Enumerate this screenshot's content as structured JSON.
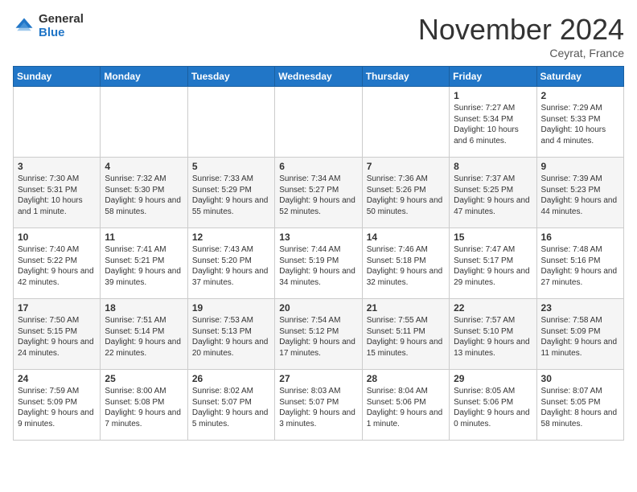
{
  "logo": {
    "general": "General",
    "blue": "Blue"
  },
  "header": {
    "month": "November 2024",
    "location": "Ceyrat, France"
  },
  "days_header": [
    "Sunday",
    "Monday",
    "Tuesday",
    "Wednesday",
    "Thursday",
    "Friday",
    "Saturday"
  ],
  "weeks": [
    [
      {
        "day": "",
        "content": ""
      },
      {
        "day": "",
        "content": ""
      },
      {
        "day": "",
        "content": ""
      },
      {
        "day": "",
        "content": ""
      },
      {
        "day": "",
        "content": ""
      },
      {
        "day": "1",
        "content": "Sunrise: 7:27 AM\nSunset: 5:34 PM\nDaylight: 10 hours and 6 minutes."
      },
      {
        "day": "2",
        "content": "Sunrise: 7:29 AM\nSunset: 5:33 PM\nDaylight: 10 hours and 4 minutes."
      }
    ],
    [
      {
        "day": "3",
        "content": "Sunrise: 7:30 AM\nSunset: 5:31 PM\nDaylight: 10 hours and 1 minute."
      },
      {
        "day": "4",
        "content": "Sunrise: 7:32 AM\nSunset: 5:30 PM\nDaylight: 9 hours and 58 minutes."
      },
      {
        "day": "5",
        "content": "Sunrise: 7:33 AM\nSunset: 5:29 PM\nDaylight: 9 hours and 55 minutes."
      },
      {
        "day": "6",
        "content": "Sunrise: 7:34 AM\nSunset: 5:27 PM\nDaylight: 9 hours and 52 minutes."
      },
      {
        "day": "7",
        "content": "Sunrise: 7:36 AM\nSunset: 5:26 PM\nDaylight: 9 hours and 50 minutes."
      },
      {
        "day": "8",
        "content": "Sunrise: 7:37 AM\nSunset: 5:25 PM\nDaylight: 9 hours and 47 minutes."
      },
      {
        "day": "9",
        "content": "Sunrise: 7:39 AM\nSunset: 5:23 PM\nDaylight: 9 hours and 44 minutes."
      }
    ],
    [
      {
        "day": "10",
        "content": "Sunrise: 7:40 AM\nSunset: 5:22 PM\nDaylight: 9 hours and 42 minutes."
      },
      {
        "day": "11",
        "content": "Sunrise: 7:41 AM\nSunset: 5:21 PM\nDaylight: 9 hours and 39 minutes."
      },
      {
        "day": "12",
        "content": "Sunrise: 7:43 AM\nSunset: 5:20 PM\nDaylight: 9 hours and 37 minutes."
      },
      {
        "day": "13",
        "content": "Sunrise: 7:44 AM\nSunset: 5:19 PM\nDaylight: 9 hours and 34 minutes."
      },
      {
        "day": "14",
        "content": "Sunrise: 7:46 AM\nSunset: 5:18 PM\nDaylight: 9 hours and 32 minutes."
      },
      {
        "day": "15",
        "content": "Sunrise: 7:47 AM\nSunset: 5:17 PM\nDaylight: 9 hours and 29 minutes."
      },
      {
        "day": "16",
        "content": "Sunrise: 7:48 AM\nSunset: 5:16 PM\nDaylight: 9 hours and 27 minutes."
      }
    ],
    [
      {
        "day": "17",
        "content": "Sunrise: 7:50 AM\nSunset: 5:15 PM\nDaylight: 9 hours and 24 minutes."
      },
      {
        "day": "18",
        "content": "Sunrise: 7:51 AM\nSunset: 5:14 PM\nDaylight: 9 hours and 22 minutes."
      },
      {
        "day": "19",
        "content": "Sunrise: 7:53 AM\nSunset: 5:13 PM\nDaylight: 9 hours and 20 minutes."
      },
      {
        "day": "20",
        "content": "Sunrise: 7:54 AM\nSunset: 5:12 PM\nDaylight: 9 hours and 17 minutes."
      },
      {
        "day": "21",
        "content": "Sunrise: 7:55 AM\nSunset: 5:11 PM\nDaylight: 9 hours and 15 minutes."
      },
      {
        "day": "22",
        "content": "Sunrise: 7:57 AM\nSunset: 5:10 PM\nDaylight: 9 hours and 13 minutes."
      },
      {
        "day": "23",
        "content": "Sunrise: 7:58 AM\nSunset: 5:09 PM\nDaylight: 9 hours and 11 minutes."
      }
    ],
    [
      {
        "day": "24",
        "content": "Sunrise: 7:59 AM\nSunset: 5:09 PM\nDaylight: 9 hours and 9 minutes."
      },
      {
        "day": "25",
        "content": "Sunrise: 8:00 AM\nSunset: 5:08 PM\nDaylight: 9 hours and 7 minutes."
      },
      {
        "day": "26",
        "content": "Sunrise: 8:02 AM\nSunset: 5:07 PM\nDaylight: 9 hours and 5 minutes."
      },
      {
        "day": "27",
        "content": "Sunrise: 8:03 AM\nSunset: 5:07 PM\nDaylight: 9 hours and 3 minutes."
      },
      {
        "day": "28",
        "content": "Sunrise: 8:04 AM\nSunset: 5:06 PM\nDaylight: 9 hours and 1 minute."
      },
      {
        "day": "29",
        "content": "Sunrise: 8:05 AM\nSunset: 5:06 PM\nDaylight: 9 hours and 0 minutes."
      },
      {
        "day": "30",
        "content": "Sunrise: 8:07 AM\nSunset: 5:05 PM\nDaylight: 8 hours and 58 minutes."
      }
    ]
  ]
}
